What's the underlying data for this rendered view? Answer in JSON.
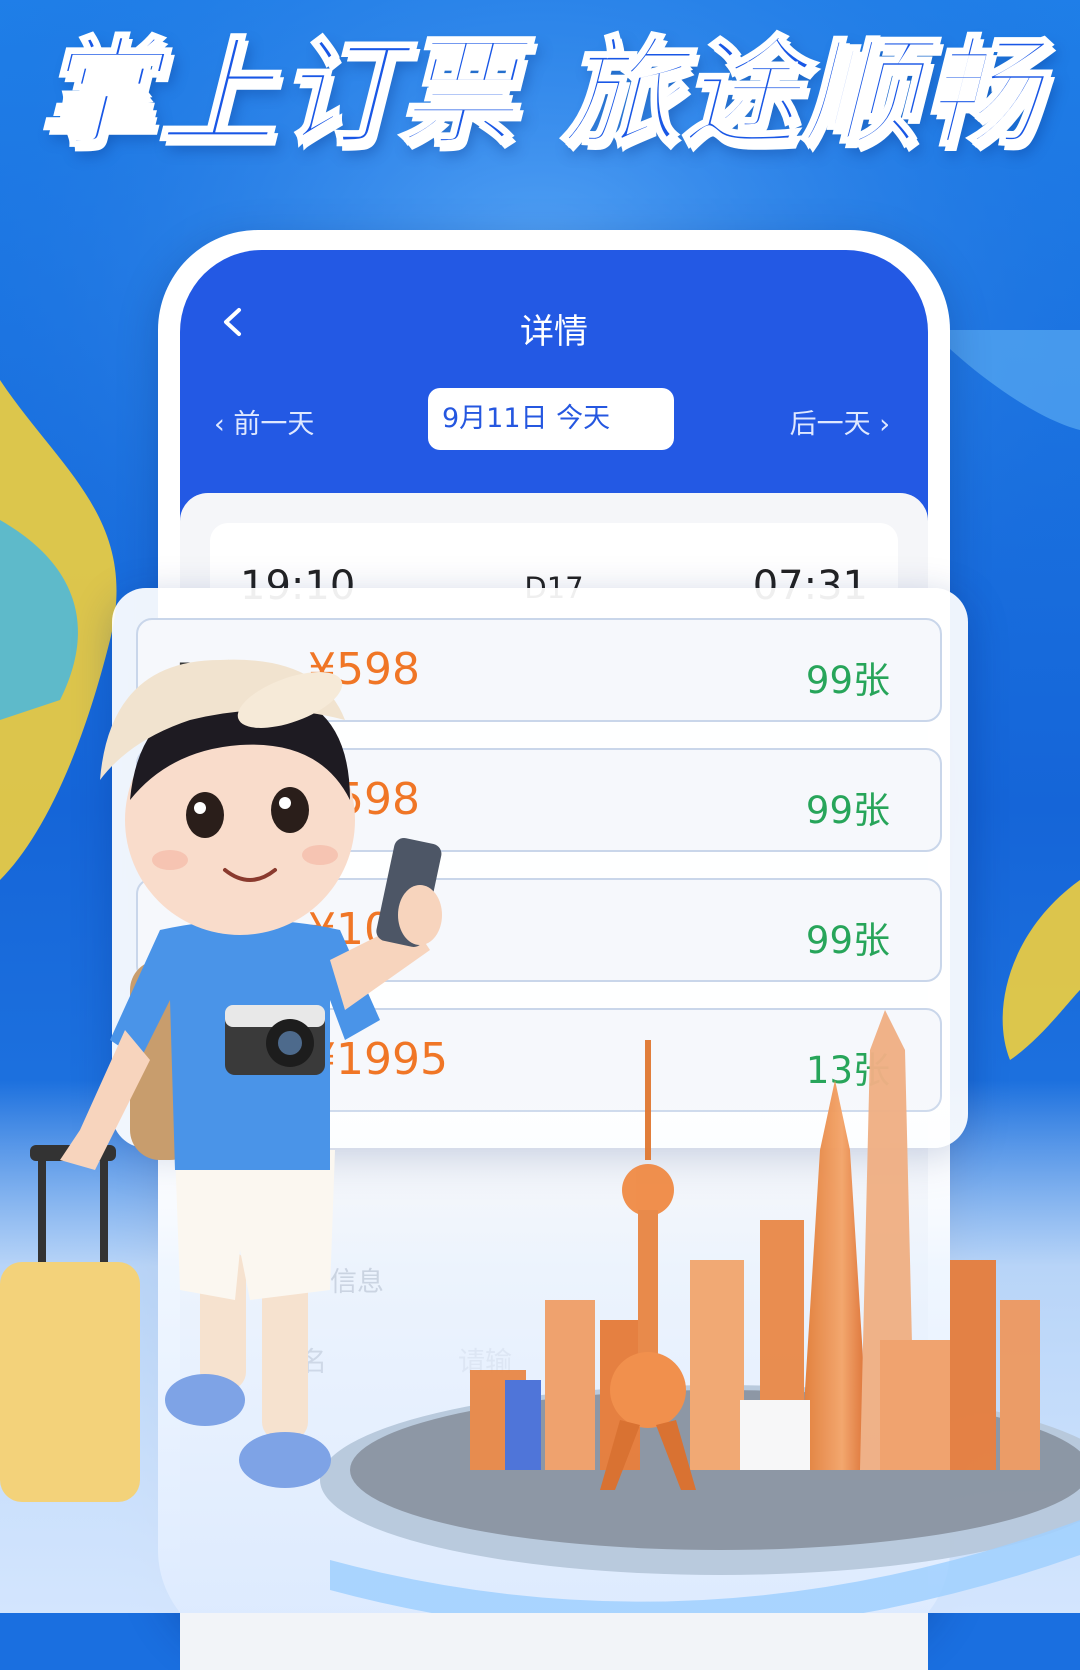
{
  "banner": {
    "headline": "掌上订票 旅途顺畅"
  },
  "app": {
    "title": "详情",
    "back_icon": "chevron-left-icon",
    "prev_day_label": "前一天",
    "next_day_label": "后一天",
    "date_label": "9月11日 今天"
  },
  "train": {
    "departure_time": "19:10",
    "train_number": "D17",
    "arrival_time": "07:31"
  },
  "seats": [
    {
      "name": "无座",
      "price": "¥598",
      "count": "99张"
    },
    {
      "name": "",
      "price": "¥598",
      "count": "99张"
    },
    {
      "name": "",
      "price": "¥10",
      "count": "99张"
    },
    {
      "name": "",
      "price": "¥1995",
      "count": "13张"
    }
  ],
  "lower_form": {
    "section_label": "信息",
    "name_label": "名",
    "placeholder": "请输"
  },
  "colors": {
    "header_blue": "#2359e4",
    "price_orange": "#f07626",
    "count_green": "#27a55a",
    "headline_blue": "#1957e6"
  }
}
